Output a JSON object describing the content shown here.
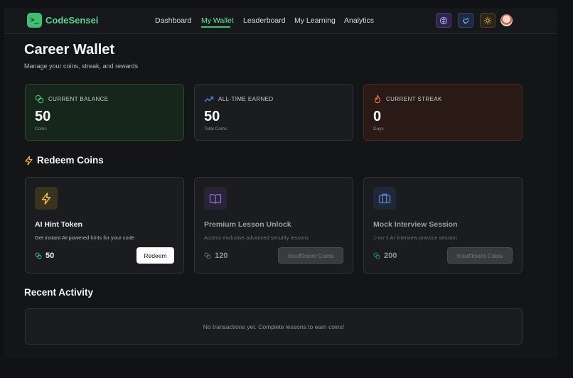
{
  "brand": {
    "logo_glyph": ">_",
    "name": "CodeSensei"
  },
  "nav": {
    "links": [
      "Dashboard",
      "My Wallet",
      "Leaderboard",
      "My Learning",
      "Analytics"
    ],
    "active": "My Wallet",
    "icons": [
      "brain-icon",
      "github-icon",
      "sun-icon",
      "avatar"
    ]
  },
  "page": {
    "title": "Career Wallet",
    "subtitle": "Manage your coins, streak, and rewards"
  },
  "stats": [
    {
      "label": "CURRENT BALANCE",
      "value": "50",
      "unit": "Coins",
      "icon": "coins-icon",
      "accent": "#3fbf74"
    },
    {
      "label": "ALL-TIME EARNED",
      "value": "50",
      "unit": "Total Coins",
      "icon": "trending-up-icon",
      "accent": "#4f8cf0"
    },
    {
      "label": "CURRENT STREAK",
      "value": "0",
      "unit": "Days",
      "icon": "flame-icon",
      "accent": "#f27a3c"
    }
  ],
  "redeem": {
    "title": "Redeem Coins",
    "items": [
      {
        "title": "AI Hint Token",
        "description": "Get instant AI-powered hints for your code",
        "price": "50",
        "button": "Redeem",
        "enabled": true,
        "icon": "lightning-icon"
      },
      {
        "title": "Premium Lesson Unlock",
        "description": "Access exclusive advanced security lessons",
        "price": "120",
        "button": "Insufficient Coins",
        "enabled": false,
        "icon": "book-icon"
      },
      {
        "title": "Mock Interview Session",
        "description": "1-on-1 AI interview practice session",
        "price": "200",
        "button": "Insufficient Coins",
        "enabled": false,
        "icon": "briefcase-icon"
      }
    ]
  },
  "recent": {
    "title": "Recent Activity",
    "empty_message": "No transactions yet. Complete lessons to earn coins!"
  }
}
